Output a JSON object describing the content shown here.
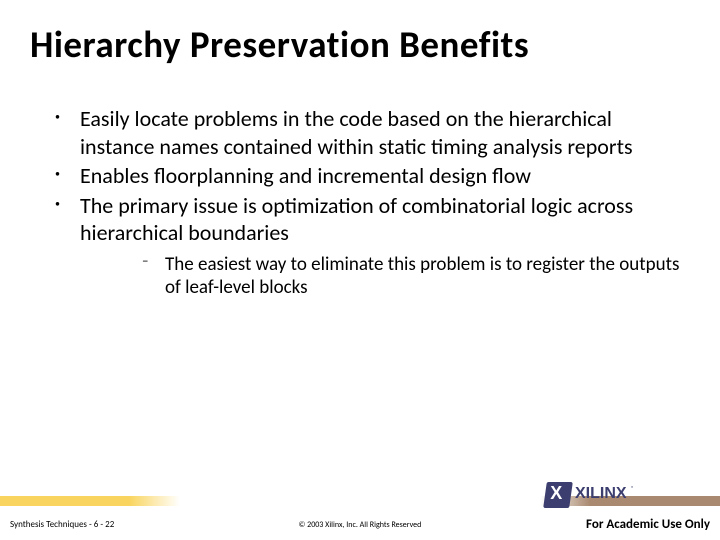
{
  "title": "Hierarchy Preservation Benefits",
  "bullets": [
    "Easily locate problems in the code based on the hierarchical instance names contained within static timing analysis reports",
    "Enables floorplanning and incremental design flow",
    "The primary issue is optimization of combinatorial logic across hierarchical boundaries"
  ],
  "sub_bullet": "The easiest way to eliminate this problem is to register the outputs of leaf-level blocks",
  "footer": {
    "left": "Synthesis Techniques  -  6  -  22",
    "center": "© 2003 Xilinx, Inc. All Rights Reserved",
    "right": "For Academic Use Only"
  },
  "logo": {
    "word": "XILINX",
    "tm": "®"
  }
}
